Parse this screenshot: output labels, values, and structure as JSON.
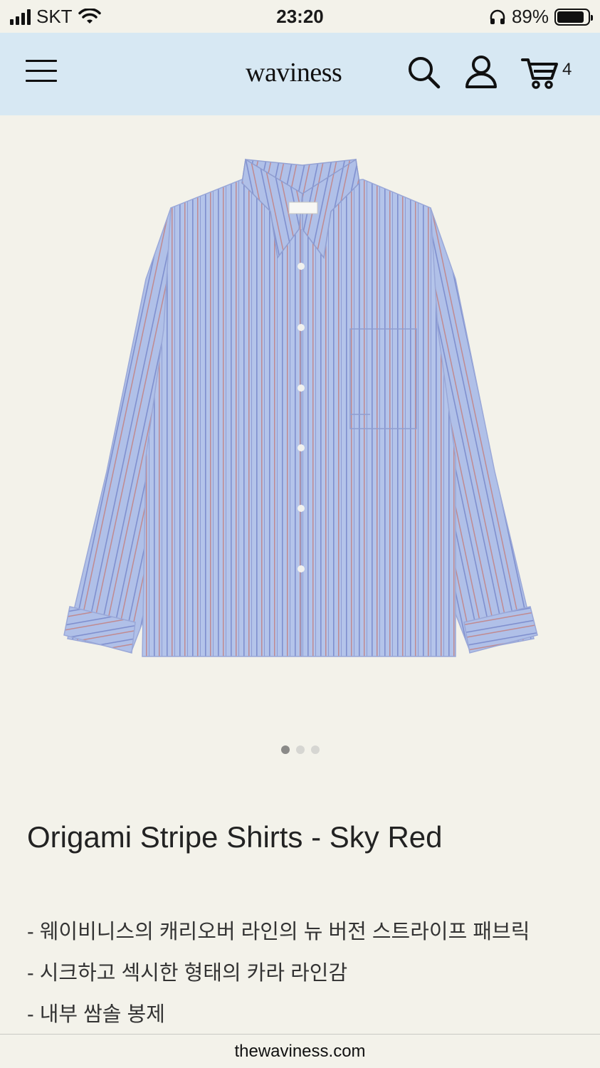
{
  "status_bar": {
    "carrier": "SKT",
    "time": "23:20",
    "battery": "89%",
    "battery_level": 0.89
  },
  "header": {
    "logo": "waviness",
    "cart_count": "4",
    "background": "#d7e8f3"
  },
  "gallery": {
    "image_count": 3,
    "active_index": 0
  },
  "product": {
    "title": "Origami Stripe Shirts - Sky Red",
    "description": [
      "- 웨이비니스의 캐리오버 라인의 뉴 버전 스트라이프 패브릭",
      "- 시크하고 섹시한 형태의 카라 라인감",
      "- 내부 쌈솔 봉제"
    ]
  },
  "browser": {
    "url": "thewaviness.com"
  }
}
